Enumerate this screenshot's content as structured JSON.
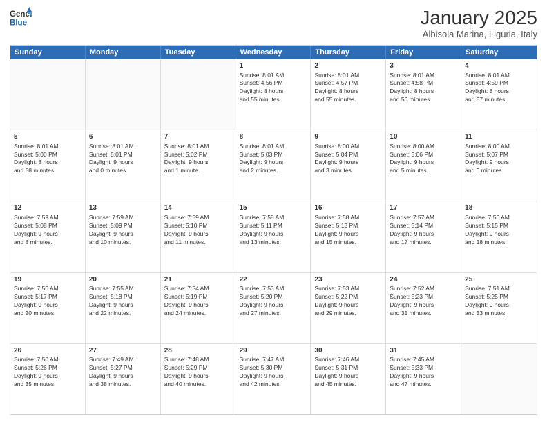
{
  "header": {
    "logo_general": "General",
    "logo_blue": "Blue",
    "month_title": "January 2025",
    "location": "Albisola Marina, Liguria, Italy"
  },
  "weekdays": [
    "Sunday",
    "Monday",
    "Tuesday",
    "Wednesday",
    "Thursday",
    "Friday",
    "Saturday"
  ],
  "rows": [
    [
      {
        "day": "",
        "info": ""
      },
      {
        "day": "",
        "info": ""
      },
      {
        "day": "",
        "info": ""
      },
      {
        "day": "1",
        "info": "Sunrise: 8:01 AM\nSunset: 4:56 PM\nDaylight: 8 hours\nand 55 minutes."
      },
      {
        "day": "2",
        "info": "Sunrise: 8:01 AM\nSunset: 4:57 PM\nDaylight: 8 hours\nand 55 minutes."
      },
      {
        "day": "3",
        "info": "Sunrise: 8:01 AM\nSunset: 4:58 PM\nDaylight: 8 hours\nand 56 minutes."
      },
      {
        "day": "4",
        "info": "Sunrise: 8:01 AM\nSunset: 4:59 PM\nDaylight: 8 hours\nand 57 minutes."
      }
    ],
    [
      {
        "day": "5",
        "info": "Sunrise: 8:01 AM\nSunset: 5:00 PM\nDaylight: 8 hours\nand 58 minutes."
      },
      {
        "day": "6",
        "info": "Sunrise: 8:01 AM\nSunset: 5:01 PM\nDaylight: 9 hours\nand 0 minutes."
      },
      {
        "day": "7",
        "info": "Sunrise: 8:01 AM\nSunset: 5:02 PM\nDaylight: 9 hours\nand 1 minute."
      },
      {
        "day": "8",
        "info": "Sunrise: 8:01 AM\nSunset: 5:03 PM\nDaylight: 9 hours\nand 2 minutes."
      },
      {
        "day": "9",
        "info": "Sunrise: 8:00 AM\nSunset: 5:04 PM\nDaylight: 9 hours\nand 3 minutes."
      },
      {
        "day": "10",
        "info": "Sunrise: 8:00 AM\nSunset: 5:06 PM\nDaylight: 9 hours\nand 5 minutes."
      },
      {
        "day": "11",
        "info": "Sunrise: 8:00 AM\nSunset: 5:07 PM\nDaylight: 9 hours\nand 6 minutes."
      }
    ],
    [
      {
        "day": "12",
        "info": "Sunrise: 7:59 AM\nSunset: 5:08 PM\nDaylight: 9 hours\nand 8 minutes."
      },
      {
        "day": "13",
        "info": "Sunrise: 7:59 AM\nSunset: 5:09 PM\nDaylight: 9 hours\nand 10 minutes."
      },
      {
        "day": "14",
        "info": "Sunrise: 7:59 AM\nSunset: 5:10 PM\nDaylight: 9 hours\nand 11 minutes."
      },
      {
        "day": "15",
        "info": "Sunrise: 7:58 AM\nSunset: 5:11 PM\nDaylight: 9 hours\nand 13 minutes."
      },
      {
        "day": "16",
        "info": "Sunrise: 7:58 AM\nSunset: 5:13 PM\nDaylight: 9 hours\nand 15 minutes."
      },
      {
        "day": "17",
        "info": "Sunrise: 7:57 AM\nSunset: 5:14 PM\nDaylight: 9 hours\nand 17 minutes."
      },
      {
        "day": "18",
        "info": "Sunrise: 7:56 AM\nSunset: 5:15 PM\nDaylight: 9 hours\nand 18 minutes."
      }
    ],
    [
      {
        "day": "19",
        "info": "Sunrise: 7:56 AM\nSunset: 5:17 PM\nDaylight: 9 hours\nand 20 minutes."
      },
      {
        "day": "20",
        "info": "Sunrise: 7:55 AM\nSunset: 5:18 PM\nDaylight: 9 hours\nand 22 minutes."
      },
      {
        "day": "21",
        "info": "Sunrise: 7:54 AM\nSunset: 5:19 PM\nDaylight: 9 hours\nand 24 minutes."
      },
      {
        "day": "22",
        "info": "Sunrise: 7:53 AM\nSunset: 5:20 PM\nDaylight: 9 hours\nand 27 minutes."
      },
      {
        "day": "23",
        "info": "Sunrise: 7:53 AM\nSunset: 5:22 PM\nDaylight: 9 hours\nand 29 minutes."
      },
      {
        "day": "24",
        "info": "Sunrise: 7:52 AM\nSunset: 5:23 PM\nDaylight: 9 hours\nand 31 minutes."
      },
      {
        "day": "25",
        "info": "Sunrise: 7:51 AM\nSunset: 5:25 PM\nDaylight: 9 hours\nand 33 minutes."
      }
    ],
    [
      {
        "day": "26",
        "info": "Sunrise: 7:50 AM\nSunset: 5:26 PM\nDaylight: 9 hours\nand 35 minutes."
      },
      {
        "day": "27",
        "info": "Sunrise: 7:49 AM\nSunset: 5:27 PM\nDaylight: 9 hours\nand 38 minutes."
      },
      {
        "day": "28",
        "info": "Sunrise: 7:48 AM\nSunset: 5:29 PM\nDaylight: 9 hours\nand 40 minutes."
      },
      {
        "day": "29",
        "info": "Sunrise: 7:47 AM\nSunset: 5:30 PM\nDaylight: 9 hours\nand 42 minutes."
      },
      {
        "day": "30",
        "info": "Sunrise: 7:46 AM\nSunset: 5:31 PM\nDaylight: 9 hours\nand 45 minutes."
      },
      {
        "day": "31",
        "info": "Sunrise: 7:45 AM\nSunset: 5:33 PM\nDaylight: 9 hours\nand 47 minutes."
      },
      {
        "day": "",
        "info": ""
      }
    ]
  ]
}
